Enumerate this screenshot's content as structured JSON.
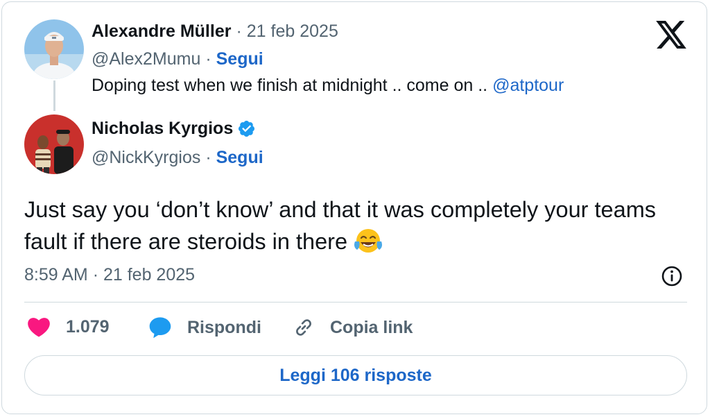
{
  "quoted_tweet": {
    "author_name": "Alexandre Müller",
    "date": "21 feb 2025",
    "handle": "@Alex2Mumu",
    "follow_label": "Segui",
    "text": "Doping test when we finish at midnight .. come on .. ",
    "mention": "@atptour"
  },
  "main_tweet": {
    "author_name": "Nicholas Kyrgios",
    "verified": true,
    "handle": "@NickKyrgios",
    "follow_label": "Segui",
    "text": "Just say you ‘don’t know’ and that it was completely your teams fault if there are steroids in there",
    "emoji": "face-with-tears-of-joy",
    "time": "8:59 AM",
    "date": "21 feb 2025"
  },
  "actions": {
    "like_count": "1.079",
    "reply_label": "Rispondi",
    "copy_link_label": "Copia link"
  },
  "read_replies_label": "Leggi 106 risposte",
  "separator": "·",
  "colors": {
    "link_blue": "#1d67c8",
    "muted_gray": "#536471",
    "heart_pink": "#f91880",
    "border_gray": "#cfd9de",
    "verified_blue": "#1d9bf0"
  },
  "icons": {
    "brand": "x-logo-icon",
    "verified": "verified-badge-icon",
    "like": "heart-icon",
    "reply": "speech-bubble-icon",
    "copy": "link-icon",
    "info": "info-icon"
  }
}
